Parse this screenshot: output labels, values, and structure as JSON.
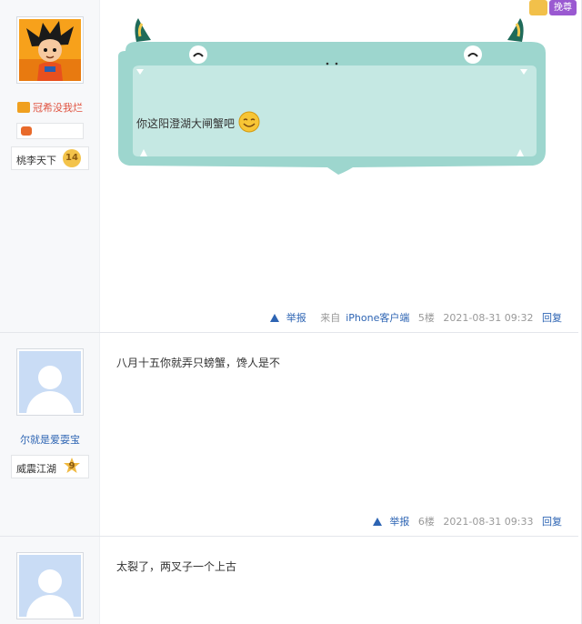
{
  "posts": [
    {
      "username": "冠希没我烂",
      "level_name": "桃李天下",
      "level": "14",
      "content": "你这阳澄湖大闸蟹吧",
      "emoji": "smile-emoji",
      "footer": {
        "report": "举报",
        "source": "来自",
        "client": "iPhone客户端",
        "floor": "5楼",
        "time": "2021-08-31 09:32",
        "reply": "回复"
      }
    },
    {
      "username": "尔就是爱耍宝",
      "level_name": "威震江湖",
      "level": "9",
      "content": "八月十五你就弄只螃蟹，馋人是不",
      "footer": {
        "report": "举报",
        "floor": "6楼",
        "time": "2021-08-31 09:33",
        "reply": "回复"
      }
    },
    {
      "content": "太裂了，两叉子一个上古"
    }
  ],
  "top_badge": {
    "label": "挽尊"
  },
  "colors": {
    "link": "#2d64b3",
    "bubble": "#c5e8e3",
    "bubble_border": "#8fd0c6"
  }
}
